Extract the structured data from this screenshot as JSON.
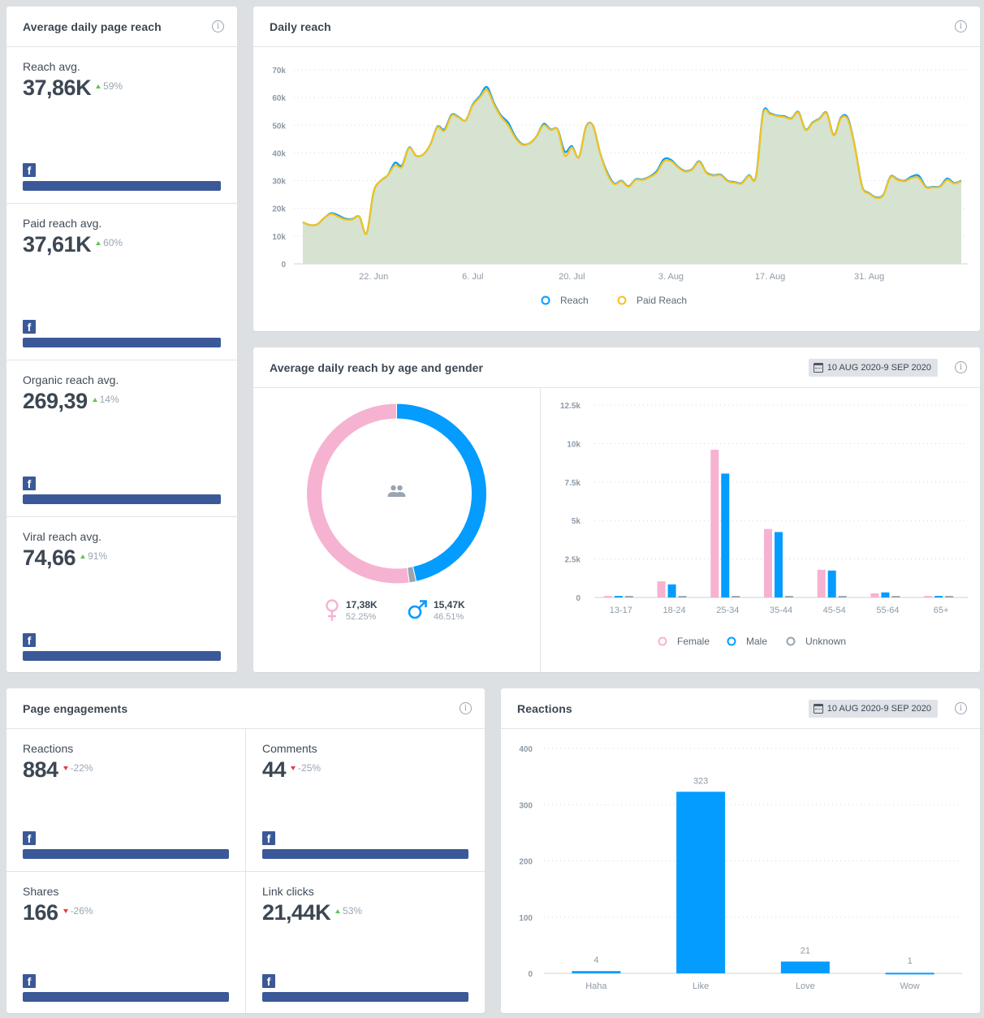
{
  "colors": {
    "reach": "#049cff",
    "paid_reach": "#f4c21b",
    "area_fill": "#d5e3d0",
    "female": "#f6b2d1",
    "male": "#049cff",
    "unknown": "#99a4ad",
    "facebook": "#3b5998",
    "delta_up": "#5cc55c",
    "delta_down": "#e83a3a"
  },
  "avg_page_reach": {
    "title": "Average daily page reach",
    "info_icon": "info-icon",
    "metrics": [
      {
        "label": "Reach avg.",
        "value": "37,86K",
        "delta": "59%",
        "direction": "up",
        "network_icon": "facebook-icon"
      },
      {
        "label": "Paid reach avg.",
        "value": "37,61K",
        "delta": "60%",
        "direction": "up",
        "network_icon": "facebook-icon"
      },
      {
        "label": "Organic reach avg.",
        "value": "269,39",
        "delta": "14%",
        "direction": "up",
        "network_icon": "facebook-icon"
      },
      {
        "label": "Viral reach avg.",
        "value": "74,66",
        "delta": "91%",
        "direction": "up",
        "network_icon": "facebook-icon"
      }
    ]
  },
  "daily_reach": {
    "title": "Daily reach",
    "info_icon": "info-icon"
  },
  "age_gender": {
    "title": "Average daily reach by age and gender",
    "date_range": "10 AUG 2020-9 SEP 2020",
    "center_icon": "people-icon",
    "female": {
      "value": "17,38K",
      "pct": "52.25%"
    },
    "male": {
      "value": "15,47K",
      "pct": "46.51%"
    }
  },
  "page_engagements": {
    "title": "Page engagements",
    "info_icon": "info-icon",
    "metrics": [
      {
        "label": "Reactions",
        "value": "884",
        "delta": "-22%",
        "direction": "down"
      },
      {
        "label": "Comments",
        "value": "44",
        "delta": "-25%",
        "direction": "down"
      },
      {
        "label": "Shares",
        "value": "166",
        "delta": "-26%",
        "direction": "down"
      },
      {
        "label": "Link clicks",
        "value": "21,44K",
        "delta": "53%",
        "direction": "up"
      }
    ]
  },
  "reactions": {
    "title": "Reactions",
    "date_range": "10 AUG 2020-9 SEP 2020",
    "info_icon": "info-icon"
  },
  "chart_data": [
    {
      "id": "daily_reach",
      "type": "area",
      "title": "Daily reach",
      "x_start": "12 Jun",
      "x_end": "9 Sep",
      "x_tick_labels": [
        "22. Jun",
        "6. Jul",
        "20. Jul",
        "3. Aug",
        "17. Aug",
        "31. Aug"
      ],
      "x_tick_day_index": [
        10,
        24,
        38,
        52,
        66,
        80
      ],
      "y_tick_labels": [
        "0",
        "10k",
        "20k",
        "30k",
        "40k",
        "50k",
        "60k",
        "70k"
      ],
      "ylim": [
        0,
        70000
      ],
      "grid": true,
      "legend": [
        "Reach",
        "Paid Reach"
      ],
      "legend_position": "bottom-center",
      "series": [
        {
          "name": "Reach",
          "values": [
            15000,
            14000,
            14200,
            16500,
            18300,
            17500,
            16300,
            16200,
            17000,
            11000,
            26000,
            30000,
            32000,
            36500,
            35500,
            42000,
            39000,
            39500,
            43000,
            49500,
            48500,
            53800,
            53000,
            51800,
            57500,
            60500,
            63800,
            58000,
            53500,
            51000,
            46000,
            43200,
            43500,
            46000,
            50500,
            48500,
            48500,
            40500,
            42500,
            38500,
            49500,
            49800,
            40000,
            33000,
            29000,
            30000,
            28000,
            30500,
            30500,
            31500,
            33500,
            37800,
            37500,
            35000,
            33500,
            34200,
            37000,
            33000,
            32000,
            32200,
            30000,
            29500,
            29200,
            32000,
            31500,
            54500,
            54300,
            53500,
            53300,
            52500,
            54800,
            48500,
            51000,
            52500,
            54500,
            46500,
            52800,
            52500,
            42000,
            28000,
            25500,
            24000,
            25000,
            31500,
            30500,
            30000,
            31500,
            31800,
            27800,
            27800,
            28000,
            30800,
            29200,
            30000
          ]
        },
        {
          "name": "Paid Reach",
          "values": [
            15000,
            14000,
            14200,
            16500,
            18000,
            17000,
            16000,
            16000,
            17000,
            11000,
            26000,
            30000,
            32000,
            35500,
            35000,
            41800,
            39000,
            39500,
            43000,
            49300,
            48000,
            53500,
            52800,
            51800,
            57200,
            60000,
            62800,
            57500,
            53000,
            50000,
            45500,
            43000,
            43500,
            46000,
            50000,
            48300,
            48300,
            39000,
            42000,
            38500,
            49300,
            49800,
            40000,
            32500,
            28800,
            29800,
            27800,
            30300,
            30300,
            31300,
            33000,
            37000,
            37000,
            34800,
            33300,
            34000,
            36800,
            32800,
            31800,
            32000,
            29800,
            29300,
            29000,
            31800,
            31300,
            54000,
            54000,
            53300,
            53000,
            52300,
            54600,
            48300,
            50800,
            52300,
            54300,
            46300,
            52500,
            52000,
            41800,
            27800,
            25300,
            23800,
            24800,
            31300,
            30300,
            29800,
            31000,
            31000,
            27600,
            27600,
            27800,
            30300,
            29000,
            29800
          ]
        }
      ]
    },
    {
      "id": "age_gender_donut",
      "type": "pie",
      "labels": [
        "Male",
        "Unknown",
        "Female"
      ],
      "values": [
        46.51,
        1.24,
        52.25
      ]
    },
    {
      "id": "age_gender_bars",
      "type": "bar",
      "categories": [
        "13-17",
        "18-24",
        "25-34",
        "35-44",
        "45-54",
        "55-64",
        "65+"
      ],
      "series": [
        {
          "name": "Female",
          "values": [
            100,
            1050,
            9600,
            4450,
            1800,
            270,
            100
          ]
        },
        {
          "name": "Male",
          "values": [
            100,
            850,
            8050,
            4250,
            1750,
            330,
            100
          ]
        },
        {
          "name": "Unknown",
          "values": [
            100,
            100,
            100,
            100,
            100,
            100,
            100
          ]
        }
      ],
      "y_tick_labels": [
        "0",
        "2.5k",
        "5k",
        "7.5k",
        "10k",
        "12.5k"
      ],
      "ylim": [
        0,
        12500
      ],
      "grid": true,
      "legend": [
        "Female",
        "Male",
        "Unknown"
      ],
      "legend_position": "bottom-center"
    },
    {
      "id": "reactions_bars",
      "type": "bar",
      "title": "Reactions",
      "categories": [
        "Haha",
        "Like",
        "Love",
        "Wow"
      ],
      "values": [
        4,
        323,
        21,
        1
      ],
      "data_labels": [
        "4",
        "323",
        "21",
        "1"
      ],
      "y_tick_labels": [
        "0",
        "100",
        "200",
        "300",
        "400"
      ],
      "ylim": [
        0,
        400
      ],
      "grid": true
    }
  ]
}
